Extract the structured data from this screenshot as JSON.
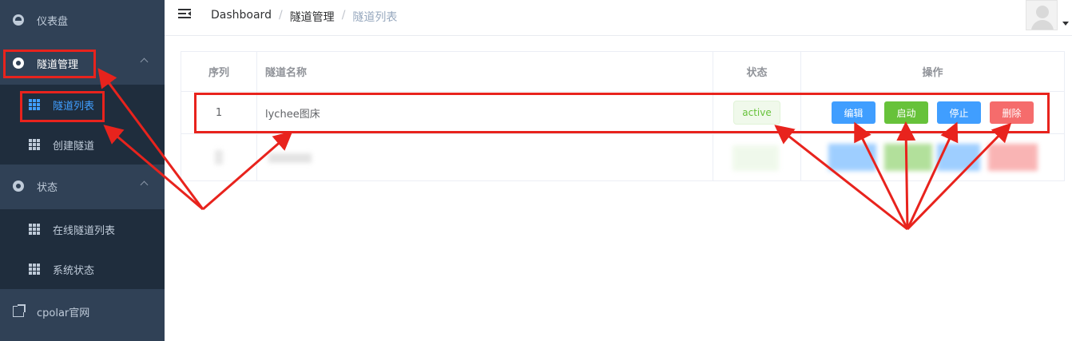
{
  "sidebar": {
    "items": [
      {
        "label": "仪表盘",
        "icon": "dashboard-icon"
      },
      {
        "label": "隧道管理",
        "icon": "tunnel-icon"
      },
      {
        "label": "隧道列表",
        "icon": "grid-icon"
      },
      {
        "label": "创建隧道",
        "icon": "grid-icon"
      },
      {
        "label": "状态",
        "icon": "status-icon"
      },
      {
        "label": "在线隧道列表",
        "icon": "grid-icon"
      },
      {
        "label": "系统状态",
        "icon": "grid-icon"
      },
      {
        "label": "cpolar官网",
        "icon": "external-link-icon"
      }
    ]
  },
  "breadcrumb": {
    "items": [
      "Dashboard",
      "隧道管理",
      "隧道列表"
    ],
    "separator": "/"
  },
  "table": {
    "headers": [
      "序列",
      "隧道名称",
      "状态",
      "操作"
    ],
    "rows": [
      {
        "index": "1",
        "name": "lychee图床",
        "status": "active"
      }
    ],
    "actions": [
      "编辑",
      "启动",
      "停止",
      "删除"
    ]
  },
  "colors": {
    "sidebar_bg": "#304156",
    "submenu_bg": "#1f2d3d",
    "accent": "#409eff",
    "success": "#67c23a",
    "danger": "#f56c6c",
    "annotation": "#e8231d"
  }
}
